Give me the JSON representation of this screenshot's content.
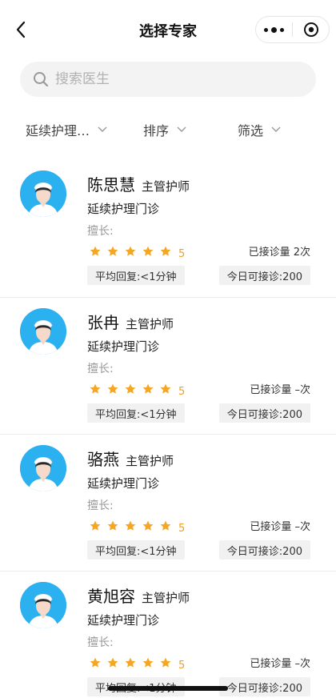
{
  "nav": {
    "title": "选择专家",
    "back_icon": "chevron-left-icon",
    "more_icon": "ellipsis-icon",
    "target_icon": "target-icon"
  },
  "search": {
    "placeholder": "搜索医生",
    "value": ""
  },
  "filters": {
    "category": "延续护理…",
    "sort": "排序",
    "filter": "筛选"
  },
  "colors": {
    "star": "#f5a623",
    "avatar_bg": "#2bb0f0",
    "badge_bg": "#f1f1f1"
  },
  "doctors": [
    {
      "name": "陈思慧",
      "title": "主管护师",
      "dept": "延续护理门诊",
      "specialty": "擅长:",
      "rating": 5,
      "rating_label": "5",
      "count": "已接诊量 2次",
      "reply": "平均回复:<1分钟",
      "today": "今日可接诊:200"
    },
    {
      "name": "张冉",
      "title": "主管护师",
      "dept": "延续护理门诊",
      "specialty": "擅长:",
      "rating": 5,
      "rating_label": "5",
      "count": "已接诊量 –次",
      "reply": "平均回复:<1分钟",
      "today": "今日可接诊:200"
    },
    {
      "name": "骆燕",
      "title": "主管护师",
      "dept": "延续护理门诊",
      "specialty": "擅长:",
      "rating": 5,
      "rating_label": "5",
      "count": "已接诊量 –次",
      "reply": "平均回复:<1分钟",
      "today": "今日可接诊:200"
    },
    {
      "name": "黄旭容",
      "title": "主管护师",
      "dept": "延续护理门诊",
      "specialty": "擅长:",
      "rating": 5,
      "rating_label": "5",
      "count": "已接诊量 –次",
      "reply": "平均回复:<1分钟",
      "today": "今日可接诊:200"
    }
  ]
}
